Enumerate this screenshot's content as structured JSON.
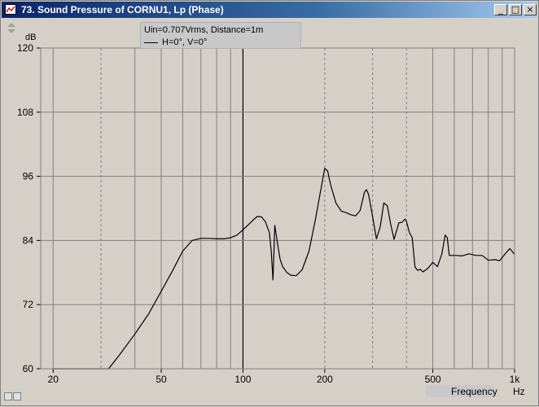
{
  "window": {
    "title": "73. Sound Pressure of CORNU1, Lp (Phase)"
  },
  "legend": {
    "info": "Uin=0.707Vrms, Distance=1m",
    "series_label": "H=0°, V=0°"
  },
  "axis": {
    "y_unit": "dB",
    "x_label": "Frequency",
    "x_unit": "Hz"
  },
  "chart_data": {
    "type": "line",
    "title": "Sound Pressure of CORNU1, Lp (Phase)",
    "xlabel": "Frequency",
    "xunit": "Hz",
    "ylabel": "dB",
    "xscale": "log",
    "xlim": [
      18,
      1000
    ],
    "ylim": [
      60,
      120
    ],
    "yticks": [
      60,
      72,
      84,
      96,
      108,
      120
    ],
    "xticks": [
      {
        "value": 20,
        "label": "20"
      },
      {
        "value": 50,
        "label": "50"
      },
      {
        "value": 100,
        "label": "100"
      },
      {
        "value": 200,
        "label": "200"
      },
      {
        "value": 500,
        "label": "500"
      },
      {
        "value": 1000,
        "label": "1k"
      }
    ],
    "grid": true,
    "legend_position": "top-left",
    "series": [
      {
        "name": "H=0°, V=0°",
        "color": "#000000",
        "x": [
          20,
          25,
          30,
          32,
          35,
          40,
          45,
          50,
          55,
          60,
          65,
          70,
          75,
          80,
          85,
          90,
          95,
          100,
          105,
          110,
          113,
          117,
          121,
          125,
          127,
          129,
          131,
          134,
          137,
          140,
          145,
          150,
          157,
          165,
          175,
          185,
          195,
          200,
          205,
          210,
          220,
          230,
          240,
          250,
          260,
          270,
          280,
          285,
          290,
          300,
          310,
          320,
          330,
          340,
          350,
          360,
          375,
          385,
          395,
          400,
          410,
          420,
          430,
          440,
          450,
          460,
          480,
          500,
          520,
          540,
          555,
          565,
          575,
          590,
          610,
          640,
          680,
          720,
          760,
          800,
          850,
          880,
          920,
          960,
          1000
        ],
        "values": [
          60,
          60,
          60,
          60,
          62.5,
          66.5,
          70.3,
          74.5,
          78.3,
          82,
          84,
          84.4,
          84.4,
          84.3,
          84.3,
          84.5,
          85,
          86,
          87,
          88,
          88.5,
          88.4,
          87.5,
          85.5,
          82,
          76.6,
          86.8,
          83.5,
          80.5,
          79.1,
          78,
          77.5,
          77.4,
          78.5,
          82,
          88,
          94.5,
          97.5,
          97,
          94.5,
          91,
          89.5,
          89.2,
          88.8,
          88.6,
          89.6,
          93,
          93.5,
          92.6,
          88.5,
          84.3,
          86.5,
          91,
          90.5,
          87,
          84.2,
          87.3,
          87.4,
          88,
          87.5,
          85.5,
          84.5,
          79,
          78.4,
          78.6,
          78.1,
          78.8,
          79.9,
          79.1,
          81.5,
          85,
          84.5,
          81.2,
          81.2,
          81.2,
          81.1,
          81.5,
          81.2,
          81.2,
          80.3,
          80.4,
          80.2,
          81.4,
          82.5,
          81.4
        ]
      }
    ]
  }
}
